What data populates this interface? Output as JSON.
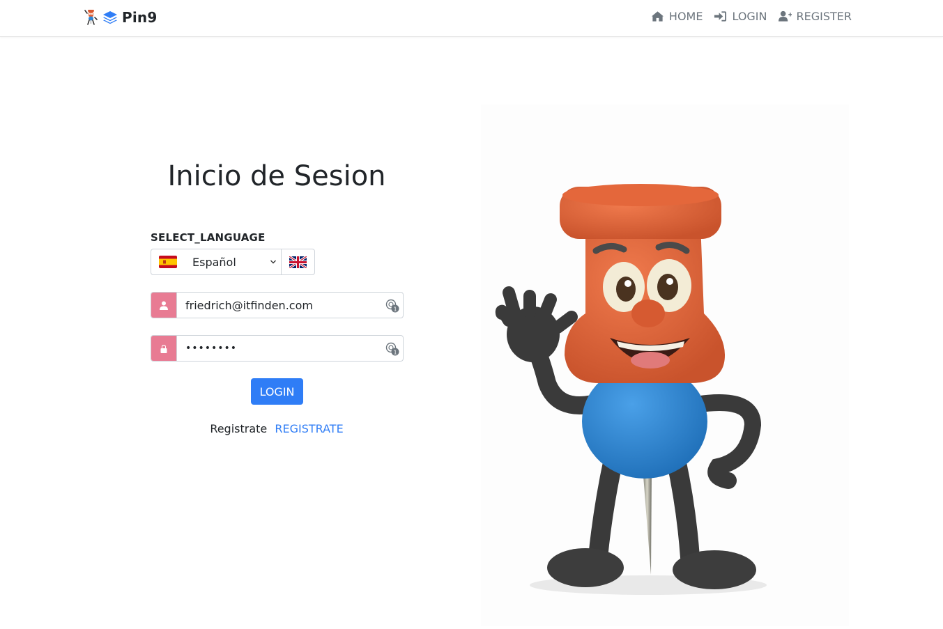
{
  "brand": {
    "name": "Pin9",
    "mascot_icon": "pin-mascot-icon",
    "logo_icon": "layers-icon"
  },
  "nav": {
    "items": [
      {
        "label": "HOME",
        "icon": "home-icon"
      },
      {
        "label": "LOGIN",
        "icon": "sign-in-icon"
      },
      {
        "label": "REGISTER",
        "icon": "user-plus-icon"
      }
    ]
  },
  "login": {
    "title": "Inicio de Sesion",
    "language_label": "SELECT_LANGUAGE",
    "language_selected": "Español",
    "language_flag": "spain-flag-icon",
    "alt_language_flag": "uk-flag-icon",
    "email_value": "friedrich@itfinden.com",
    "password_value": "••••••••",
    "login_button": "LOGIN",
    "register_text": "Registrate",
    "register_link": "REGISTRATE"
  },
  "colors": {
    "accent": "#2f7df6",
    "addon": "#e87b93",
    "nav_text": "#6c757d",
    "mascot_head": "#e0643a",
    "mascot_body": "#2f86d6"
  }
}
